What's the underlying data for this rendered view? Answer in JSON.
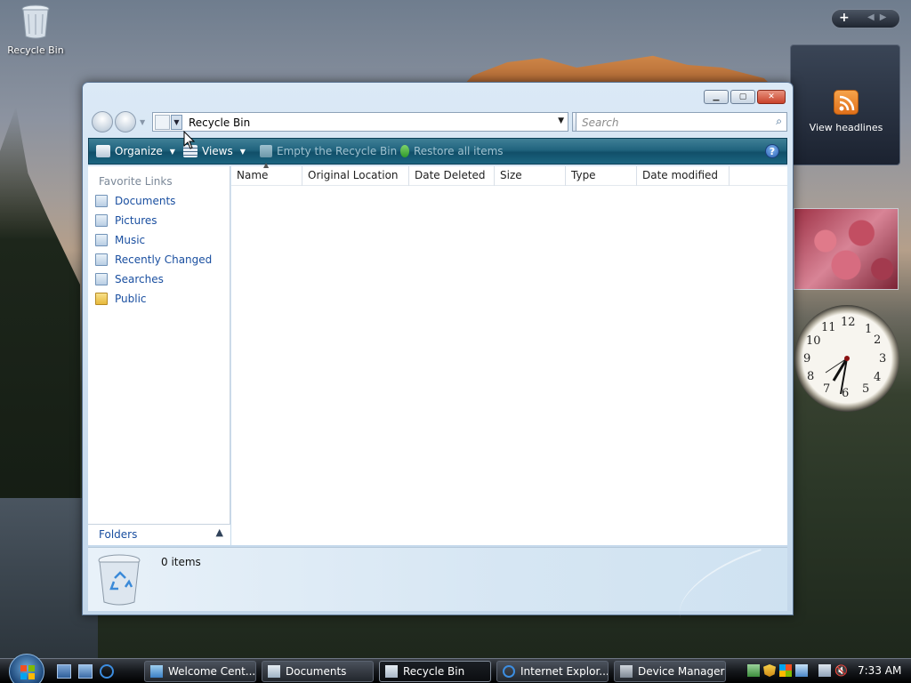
{
  "desktop": {
    "recycle_bin_label": "Recycle Bin"
  },
  "gadgets": {
    "feed_label": "View headlines",
    "clock_numbers": [
      "12",
      "1",
      "2",
      "3",
      "4",
      "5",
      "6",
      "7",
      "8",
      "9",
      "10",
      "11"
    ]
  },
  "window": {
    "address": "Recycle Bin",
    "search_placeholder": "Search",
    "toolbar": {
      "organize": "Organize",
      "views": "Views",
      "empty": "Empty the Recycle Bin",
      "restore": "Restore all items",
      "help": "?"
    },
    "nav": {
      "header": "Favorite Links",
      "links": [
        {
          "label": "Documents",
          "icon": "documents-icon"
        },
        {
          "label": "Pictures",
          "icon": "pictures-icon"
        },
        {
          "label": "Music",
          "icon": "music-icon"
        },
        {
          "label": "Recently Changed",
          "icon": "recently-changed-icon"
        },
        {
          "label": "Searches",
          "icon": "searches-icon"
        },
        {
          "label": "Public",
          "icon": "public-folder-icon"
        }
      ],
      "folders": "Folders"
    },
    "columns": [
      "Name",
      "Original Location",
      "Date Deleted",
      "Size",
      "Type",
      "Date modified"
    ],
    "details": {
      "count": "0 items"
    }
  },
  "taskbar": {
    "tasks": [
      {
        "label": "Welcome Cent...",
        "active": false
      },
      {
        "label": "Documents",
        "active": false
      },
      {
        "label": "Recycle Bin",
        "active": true
      },
      {
        "label": "Internet Explor...",
        "active": false
      },
      {
        "label": "Device Manager",
        "active": false
      }
    ],
    "time": "7:33 AM"
  },
  "colors": {
    "accent": "#1a4fa0",
    "command_bar": "#21647e",
    "close_button": "#c9422a"
  }
}
